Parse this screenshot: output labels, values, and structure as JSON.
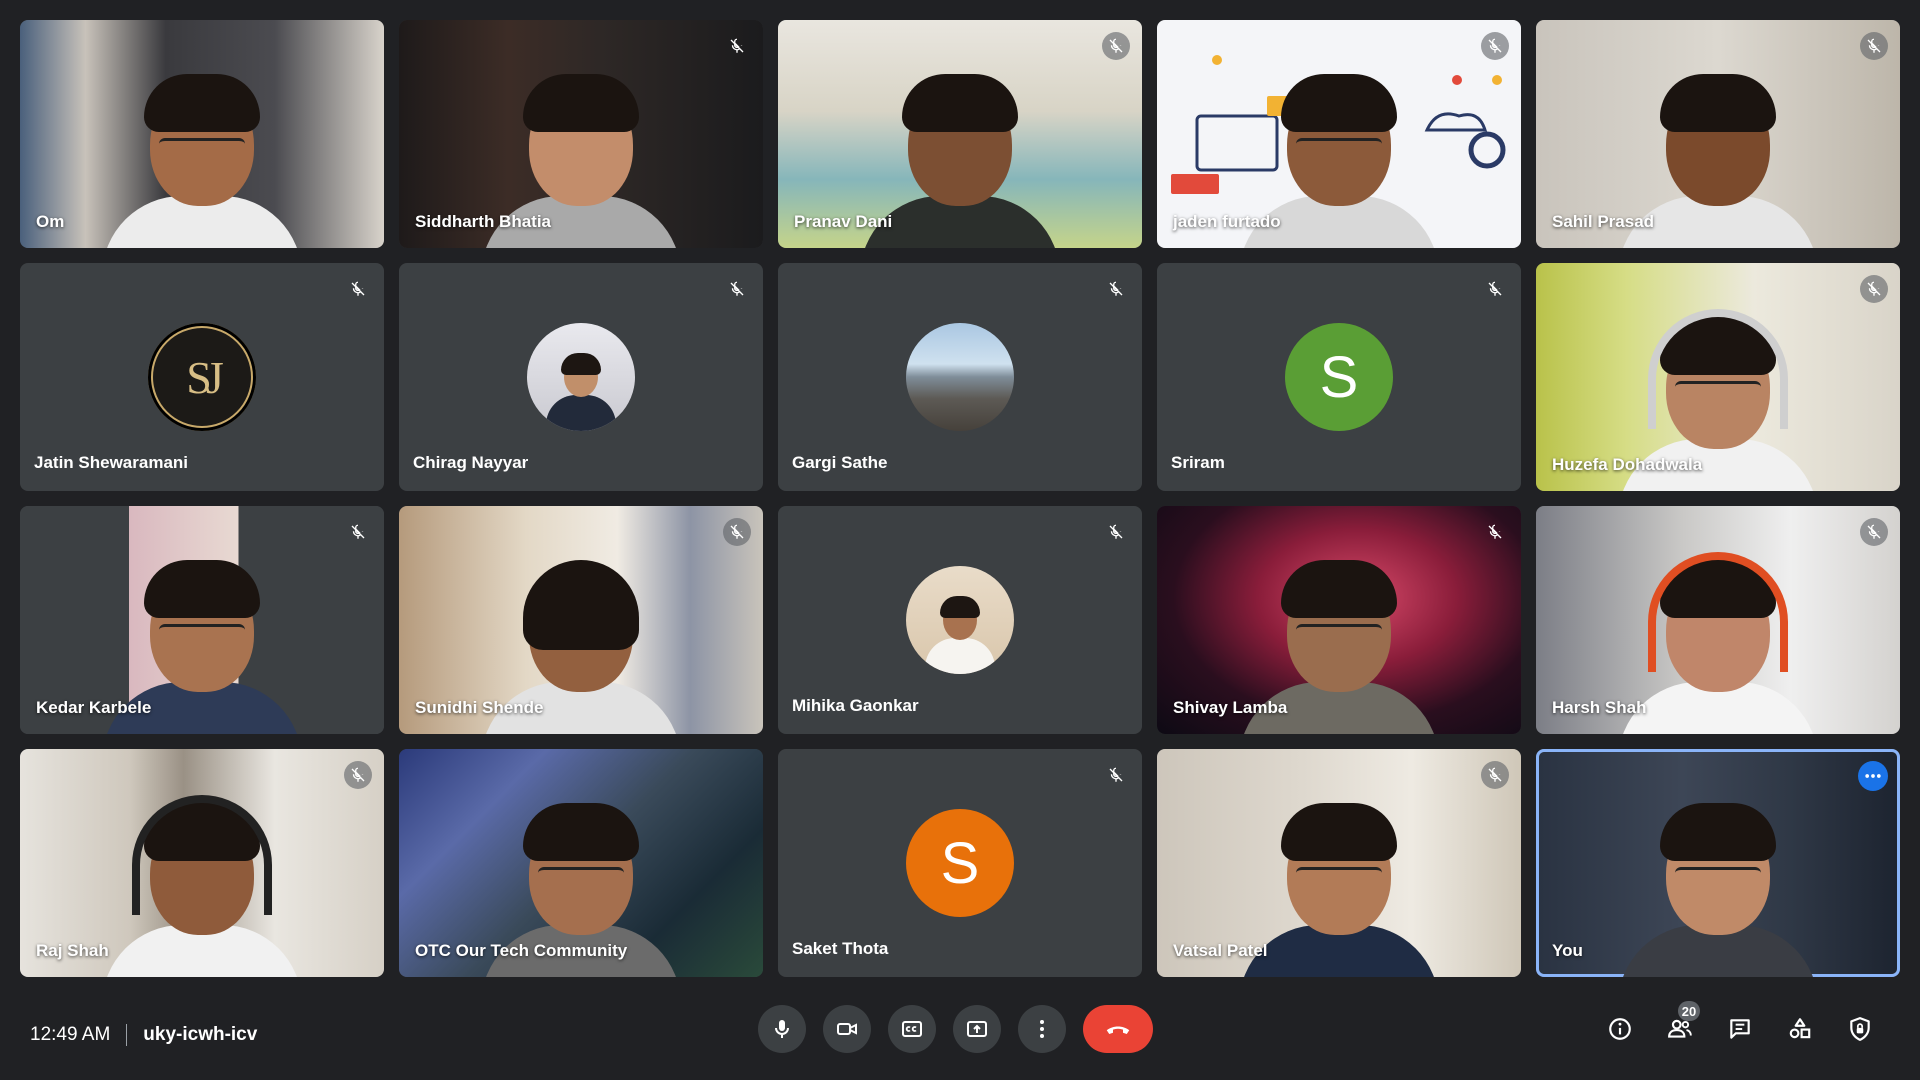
{
  "participants": [
    {
      "name": "Om",
      "muted": false
    },
    {
      "name": "Siddharth Bhatia",
      "muted": true
    },
    {
      "name": "Pranav Dani",
      "muted": true
    },
    {
      "name": "jaden furtado",
      "muted": true
    },
    {
      "name": "Sahil Prasad",
      "muted": true
    },
    {
      "name": "Jatin Shewaramani",
      "muted": true,
      "avatar_text": "SJ"
    },
    {
      "name": "Chirag Nayyar",
      "muted": true
    },
    {
      "name": "Gargi Sathe",
      "muted": true
    },
    {
      "name": "Sriram",
      "muted": true,
      "avatar_letter": "S",
      "avatar_color": "#5a9e35"
    },
    {
      "name": "Huzefa Dohadwala",
      "muted": true
    },
    {
      "name": "Kedar Karbele",
      "muted": true
    },
    {
      "name": "Sunidhi Shende",
      "muted": true
    },
    {
      "name": "Mihika Gaonkar",
      "muted": true
    },
    {
      "name": "Shivay Lamba",
      "muted": true
    },
    {
      "name": "Harsh Shah",
      "muted": true
    },
    {
      "name": "Raj Shah",
      "muted": true
    },
    {
      "name": "OTC Our Tech Community",
      "muted": false
    },
    {
      "name": "Saket Thota",
      "muted": true,
      "avatar_letter": "S",
      "avatar_color": "#e8710a"
    },
    {
      "name": "Vatsal Patel",
      "muted": true
    },
    {
      "name": "You",
      "muted": false,
      "self": true
    }
  ],
  "meeting": {
    "time": "12:49 AM",
    "code": "uky-icwh-icv"
  },
  "toolbar": {
    "participant_count": "20"
  },
  "icons": {
    "mute": "mic-off-icon",
    "mic": "mic-icon",
    "camera": "videocam-icon",
    "captions": "closed-caption-icon",
    "present": "present-to-all-icon",
    "more": "more-vert-icon",
    "end_call": "call-end-icon",
    "info": "info-icon",
    "people": "people-icon",
    "chat": "chat-icon",
    "activities": "activities-icon",
    "host_controls": "shield-lock-icon"
  },
  "colors": {
    "background": "#202124",
    "tile": "#3c4043",
    "end_call": "#ea4335",
    "self_border": "#8ab4f8",
    "accent": "#1a73e8"
  }
}
